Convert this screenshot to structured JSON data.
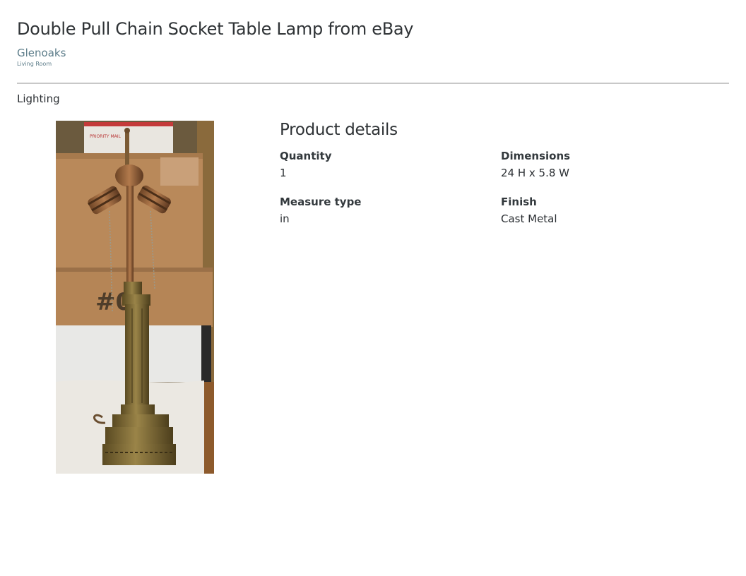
{
  "page": {
    "title": "Double Pull Chain Socket Table Lamp from eBay",
    "project": "Glenoaks",
    "room": "Living Room",
    "category": "Lighting"
  },
  "product": {
    "image_alt": "Brass double socket table lamp with pull chains",
    "box_label": "PRIORITY MAIL",
    "box_mark": "#0"
  },
  "details": {
    "heading": "Product details",
    "quantity_label": "Quantity",
    "quantity_value": "1",
    "dimensions_label": "Dimensions",
    "dimensions_value": "24 H x 5.8 W",
    "measure_label": "Measure type",
    "measure_value": "in",
    "finish_label": "Finish",
    "finish_value": "Cast Metal"
  },
  "colors": {
    "link": "#5d7d8a",
    "divider": "#c8c8c8",
    "text": "#2b2f33"
  }
}
